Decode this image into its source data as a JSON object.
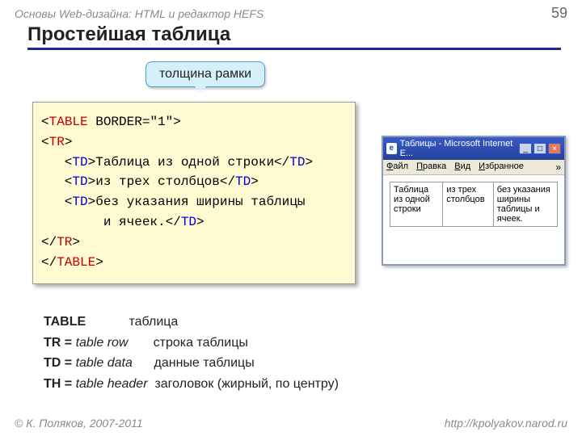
{
  "header": {
    "course": "Основы Web-дизайна: HTML и редактор HEFS",
    "page": "59"
  },
  "title": "Простейшая таблица",
  "callout": "толщина рамки",
  "code": {
    "l1a": "<",
    "l1b": "TABLE",
    "l1c": " BORDER=\"1\">",
    "l2a": "<",
    "l2b": "TR",
    "l2c": ">",
    "l3a": "   <",
    "l3b": "TD",
    "l3c": ">Таблица из одной строки</",
    "l3d": "TD",
    "l3e": ">",
    "l4a": "   <",
    "l4b": "TD",
    "l4c": ">из трех столбцов</",
    "l4d": "TD",
    "l4e": ">",
    "l5a": "   <",
    "l5b": "TD",
    "l5c": ">без указания ширины таблицы",
    "l6": "        и ячеек.</",
    "l6b": "TD",
    "l6c": ">",
    "l7a": "</",
    "l7b": "TR",
    "l7c": ">",
    "l8a": "</",
    "l8b": "TABLE",
    "l8c": ">"
  },
  "browser": {
    "title": "Таблицы - Microsoft Internet E...",
    "menu": {
      "file": "Файл",
      "edit": "Правка",
      "view": "Вид",
      "fav": "Избранное"
    },
    "cells": {
      "c1": "Таблица из одной строки",
      "c2": "из трех столбцов",
      "c3": "без указания ширины таблицы и ячеек."
    }
  },
  "defs": {
    "d1t": "TABLE",
    "d1r": "таблица",
    "d2t": "TR = ",
    "d2e": "table row",
    "d2r": "строка таблицы",
    "d3t": "TD = ",
    "d3e": "table data",
    "d3r": "данные таблицы",
    "d4t": "TH = ",
    "d4e": "table header",
    "d4r": "заголовок (жирный, по центру)"
  },
  "footer": {
    "copyright": "© К. Поляков, 2007-2011",
    "url": "http://kpolyakov.narod.ru"
  },
  "icons": {
    "ie": "e",
    "min": "_",
    "max": "□",
    "close": "×",
    "chev": "»"
  }
}
